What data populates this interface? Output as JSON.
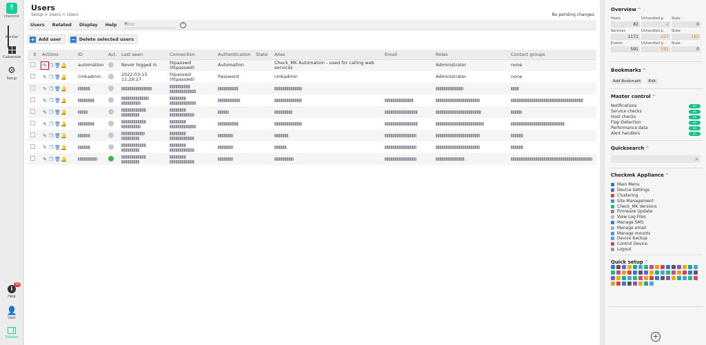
{
  "nav": {
    "logo_text": "checkmk",
    "items": [
      {
        "label": "Monitor",
        "icon": "monitor-icon"
      },
      {
        "label": "Customize",
        "icon": "customize-icon"
      },
      {
        "label": "Setup",
        "icon": "setup-gear-icon"
      }
    ],
    "bottom": [
      {
        "label": "Help",
        "icon": "help-icon",
        "badge": "10"
      },
      {
        "label": "User",
        "icon": "user-icon"
      },
      {
        "label": "Sidebar",
        "icon": "sidebar-icon"
      }
    ]
  },
  "page": {
    "title": "Users",
    "breadcrumb": "Setup > Users > Users",
    "pending": "No pending changes"
  },
  "menubar": {
    "items": [
      "Users",
      "Related",
      "Display",
      "Help"
    ],
    "filter_placeholder": "Filter"
  },
  "buttons": {
    "add_user": "Add user",
    "delete_selected": "Delete selected users"
  },
  "table": {
    "headers": {
      "select": "X",
      "actions": "Actions",
      "id": "ID",
      "act": "Act.",
      "last_seen": "Last seen",
      "connection": "Connection",
      "authentication": "Authentication",
      "state": "State",
      "alias": "Alias",
      "email": "Email",
      "roles": "Roles",
      "contact_groups": "Contact groups"
    },
    "rows": [
      {
        "id": "automation",
        "last_seen": "Never logged in",
        "connection_1": "htpasswd",
        "connection_2": "(htpasswd)",
        "authentication": "Automation",
        "alias_1": "Check_MK Automation - used for calling web",
        "alias_2": "services",
        "roles": "Administrator",
        "contact_groups": "none"
      },
      {
        "id": "cmkadmin",
        "last_seen_1": "2022-03-15",
        "last_seen_2": "11:29:27",
        "connection_1": "htpasswd",
        "connection_2": "(htpasswd)",
        "authentication": "Password",
        "alias": "cmkadmin",
        "roles": "Administrator",
        "contact_groups": "none"
      }
    ]
  },
  "sidebar": {
    "overview": {
      "title": "Overview",
      "rows": [
        {
          "label": "Hosts",
          "value": "82",
          "unhandled_label": "Unhandled p.",
          "unhandled": "2",
          "stale_label": "Stale",
          "stale": "0"
        },
        {
          "label": "Services",
          "value": "1171",
          "unhandled_label": "Unhandled p.",
          "unhandled": "227",
          "stale_label": "Stale",
          "stale": "185"
        },
        {
          "label": "Events",
          "value": "591",
          "unhandled_label": "Unhandled p.",
          "unhandled": "591",
          "stale_label": "Stale",
          "stale": "0"
        }
      ]
    },
    "bookmarks": {
      "title": "Bookmarks",
      "add": "Add Bookmark",
      "edit": "Edit"
    },
    "master_control": {
      "title": "Master control",
      "toggle_label": "on",
      "items": [
        "Notifications",
        "Service checks",
        "Host checks",
        "Flap Detection",
        "Performance data",
        "Alert handlers"
      ]
    },
    "quicksearch": {
      "title": "Quicksearch"
    },
    "appliance": {
      "title": "Checkmk Appliance",
      "items": [
        "Main Menu",
        "Device Settings",
        "Clustering",
        "Site Management",
        "Check_MK Versions",
        "Firmware Update",
        "View Log Files",
        "Manage SMS",
        "Manage email",
        "Manage mounts",
        "Device backup",
        "Control Device",
        "Logout"
      ]
    },
    "quick_setup": {
      "title": "Quick setup"
    }
  },
  "colors": {
    "brand": "#15d1a0",
    "accent_blue": "#2e7bd6",
    "toggle_green": "#18c08b",
    "warn_orange": "#e58a2a"
  }
}
